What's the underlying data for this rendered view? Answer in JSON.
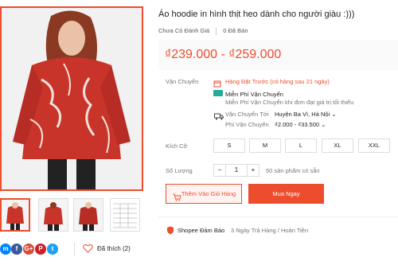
{
  "product": {
    "title": "Áo hoodie in hình thịt heo dành cho người giàu :)))",
    "rating_text": "Chưa Có Đánh Giá",
    "sold_count": "0",
    "sold_label": "Đã Bán",
    "price": "₫239.000 - ₫259.000"
  },
  "shipping": {
    "label": "Vận Chuyển",
    "preorder": "Hàng Đặt Trước (có hàng sau 21 ngày)",
    "free_title": "Miễn Phí Vận Chuyển",
    "free_desc": "Miễn Phí Vận Chuyển khi đơn đạt giá trị tối thiểu",
    "to_label": "Vận Chuyển Tới",
    "to_value": "Huyện Ba Vì, Hà Nội",
    "fee_label": "Phí Vận Chuyển",
    "fee_value": "₫2.000 - ₫33.500"
  },
  "size": {
    "label": "Kích Cỡ",
    "options": [
      "S",
      "M",
      "L",
      "XL",
      "XXL"
    ]
  },
  "quantity": {
    "label": "Số Lượng",
    "minus": "−",
    "value": "1",
    "plus": "+",
    "available": "50 sản phẩm có sẵn"
  },
  "actions": {
    "add_to_cart": "Thêm Vào Giỏ Hàng",
    "buy_now": "Mua Ngay"
  },
  "social": {
    "icons": [
      "messenger-icon",
      "facebook-icon",
      "google-plus-icon",
      "pinterest-icon",
      "twitter-icon"
    ],
    "letters": [
      "m",
      "f",
      "G+",
      "P",
      "t"
    ],
    "like_text": "Đã thích (2)"
  },
  "guarantee": {
    "brand": "Shopee Đảm Bảo",
    "text": "3 Ngày Trả Hàng / Hoàn Tiền"
  },
  "colors": {
    "accent": "#ee4d2d",
    "teal": "#26aa99"
  }
}
